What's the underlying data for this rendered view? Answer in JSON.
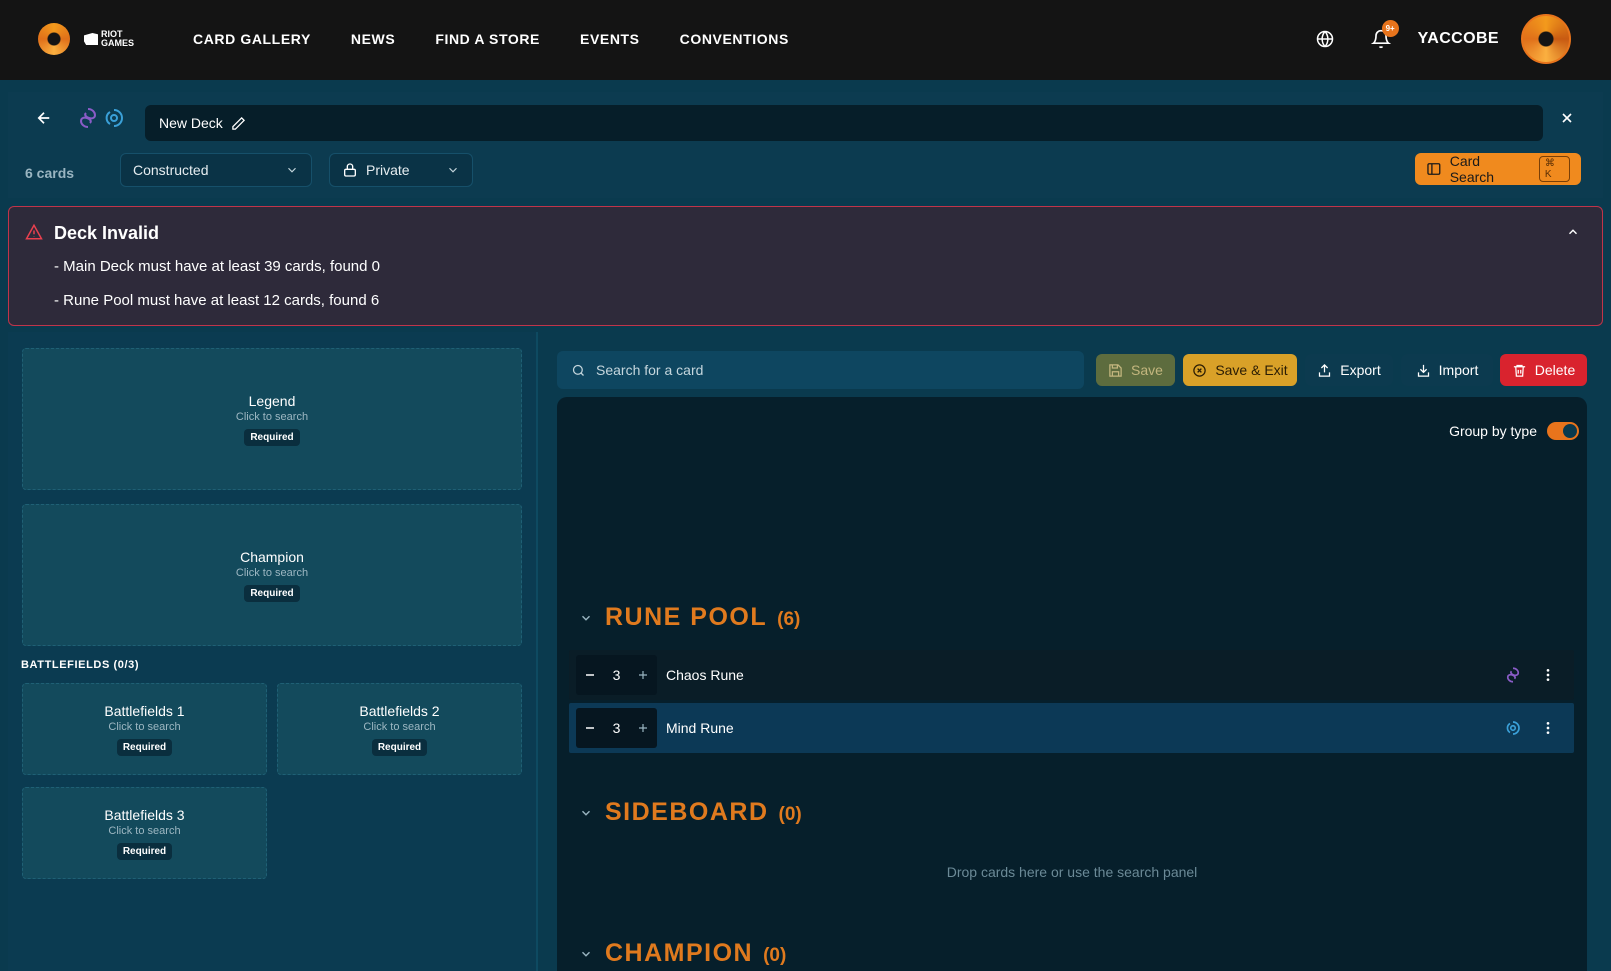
{
  "nav": {
    "brand": "RIOT GAMES",
    "links": [
      "CARD GALLERY",
      "NEWS",
      "FIND A STORE",
      "EVENTS",
      "CONVENTIONS"
    ],
    "notifications_badge": "9+",
    "username": "YACCOBE"
  },
  "deck": {
    "name": "New Deck",
    "card_count": "6 cards",
    "format": "Constructed",
    "visibility": "Private",
    "card_search_label": "Card Search",
    "card_search_shortcut": "⌘ K"
  },
  "alert": {
    "title": "Deck Invalid",
    "items": [
      "- Main Deck must have at least 39 cards, found 0",
      "- Rune Pool must have at least 12 cards, found 6"
    ]
  },
  "slots": {
    "legend": {
      "title": "Legend",
      "sub": "Click to search",
      "badge": "Required"
    },
    "champion": {
      "title": "Champion",
      "sub": "Click to search",
      "badge": "Required"
    },
    "battlefields_label": "BATTLEFIELDS (0/3)",
    "battlefields": [
      {
        "title": "Battlefields 1",
        "sub": "Click to search",
        "badge": "Required"
      },
      {
        "title": "Battlefields 2",
        "sub": "Click to search",
        "badge": "Required"
      },
      {
        "title": "Battlefields 3",
        "sub": "Click to search",
        "badge": "Required"
      }
    ]
  },
  "toolbar": {
    "search_placeholder": "Search for a card",
    "save": "Save",
    "save_exit": "Save & Exit",
    "export": "Export",
    "import": "Import",
    "delete": "Delete"
  },
  "deck_list": {
    "group_by_type": "Group by type",
    "group_by_type_on": true,
    "sections": [
      {
        "name": "RUNE POOL",
        "count": "(6)"
      },
      {
        "name": "SIDEBOARD",
        "count": "(0)"
      },
      {
        "name": "CHAMPION",
        "count": "(0)"
      }
    ],
    "rune_cards": [
      {
        "qty": "3",
        "name": "Chaos Rune",
        "domain": "chaos-icon"
      },
      {
        "qty": "3",
        "name": "Mind Rune",
        "domain": "mind-icon"
      }
    ],
    "sideboard_empty": "Drop cards here or use the search panel"
  },
  "colors": {
    "accent": "#e8741c",
    "danger": "#d9232e",
    "chaos": "#8a5cc7",
    "mind": "#3aa0d8"
  }
}
